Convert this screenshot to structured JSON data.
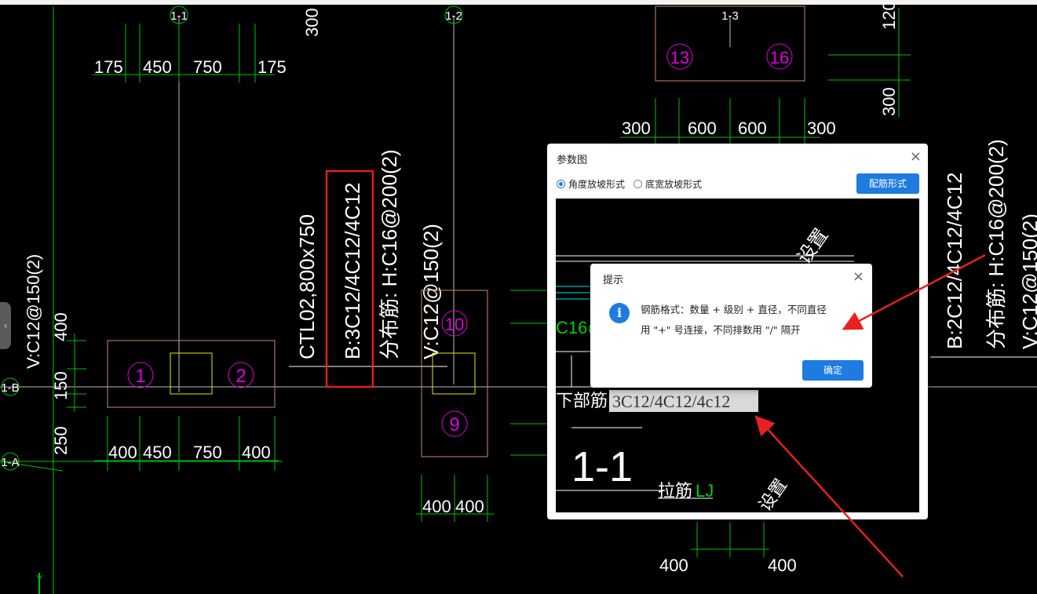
{
  "canvas": {
    "axes": [
      "1-1",
      "1-2",
      "1-3",
      "1-B",
      "1-A"
    ],
    "dims": {
      "top_left": [
        "175",
        "450",
        "750",
        "175"
      ],
      "bottom_left": [
        "400",
        "450",
        "750",
        "400"
      ],
      "left_vertical": [
        "400",
        "150",
        "250"
      ],
      "top_small": "300",
      "top_right": [
        "300",
        "600",
        "600",
        "300"
      ],
      "right_vertical": [
        "120",
        "300"
      ],
      "col_bottom": [
        "400",
        "400"
      ],
      "far_bottom": [
        "400",
        "400"
      ]
    },
    "labels": {
      "ctl": "CTL02,800x750",
      "bottom_rebar": "B:3C12/4C12/4C12",
      "dist": "分布筋: H:C16@200(2)",
      "vert_mid": "V:C12@150(2)",
      "vert_left": "V:C12@150(2)",
      "right_b": "B:2C12/4C12/4C12",
      "right_dist": "分布筋: H:C16@200(2)",
      "right_v": "V:C12@150(2)"
    },
    "marks": [
      "1",
      "2",
      "9",
      "10",
      "13",
      "16"
    ],
    "y_axis": "Y"
  },
  "param_dialog": {
    "title": "参数图",
    "radio_angle": "角度放坡形式",
    "radio_width": "底宽放坡形式",
    "rebar_button": "配筋形式",
    "preview": {
      "settings_text": "设置",
      "c16": "C16@",
      "bottom_label": "下部筋",
      "bottom_value": "3C12/4C12/4c12",
      "section": "1-1",
      "tie_label": "拉筋",
      "tie_value": "LJ",
      "settings_text2": "设置"
    }
  },
  "tip_dialog": {
    "title": "提示",
    "message_line1": "钢筋格式：数量 + 级别 + 直径，不同直径",
    "message_line2": "用 \"+\" 号连接，不同排数用 \"/\" 隔开",
    "ok": "确定"
  }
}
